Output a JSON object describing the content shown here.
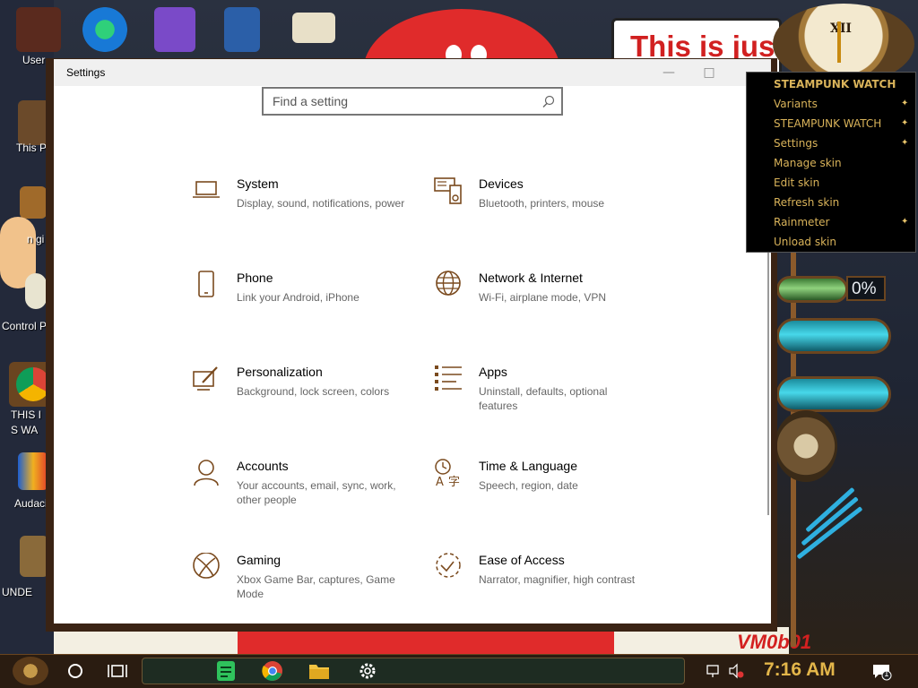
{
  "desktop": {
    "banner_text": "This is jus",
    "watermark": "VM0b01",
    "icons": [
      {
        "label": "User"
      },
      {
        "label": "This P"
      },
      {
        "label": "n gi"
      },
      {
        "label": "Control P"
      },
      {
        "label": "THIS I"
      },
      {
        "label": "S WA"
      },
      {
        "label": "Audaci"
      },
      {
        "label": "UNDE"
      }
    ]
  },
  "gauges": {
    "percent": "0%"
  },
  "window": {
    "title": "Settings",
    "search": {
      "placeholder": "Find a setting"
    },
    "categories": [
      {
        "title": "System",
        "desc": "Display, sound, notifications, power",
        "icon": "laptop-icon"
      },
      {
        "title": "Devices",
        "desc": "Bluetooth, printers, mouse",
        "icon": "devices-icon"
      },
      {
        "title": "Phone",
        "desc": "Link your Android, iPhone",
        "icon": "phone-icon"
      },
      {
        "title": "Network & Internet",
        "desc": "Wi-Fi, airplane mode, VPN",
        "icon": "globe-icon"
      },
      {
        "title": "Personalization",
        "desc": "Background, lock screen, colors",
        "icon": "paint-brush-icon"
      },
      {
        "title": "Apps",
        "desc": "Uninstall, defaults, optional features",
        "icon": "apps-list-icon"
      },
      {
        "title": "Accounts",
        "desc": "Your accounts, email, sync, work, other people",
        "icon": "person-icon"
      },
      {
        "title": "Time & Language",
        "desc": "Speech, region, date",
        "icon": "time-language-icon"
      },
      {
        "title": "Gaming",
        "desc": "Xbox Game Bar, captures, Game Mode",
        "icon": "xbox-icon"
      },
      {
        "title": "Ease of Access",
        "desc": "Narrator, magnifier, high contrast",
        "icon": "ease-of-access-icon"
      }
    ]
  },
  "menu": {
    "header": "STEAMPUNK WATCH",
    "items": [
      {
        "label": "Variants",
        "submenu": true
      },
      {
        "label": "STEAMPUNK WATCH",
        "submenu": true
      },
      {
        "label": "Settings",
        "submenu": true
      },
      {
        "label": "Manage skin",
        "submenu": false
      },
      {
        "label": "Edit skin",
        "submenu": false
      },
      {
        "label": "Refresh skin",
        "submenu": false
      },
      {
        "label": "Rainmeter",
        "submenu": true
      },
      {
        "label": "Unload skin",
        "submenu": false
      }
    ]
  },
  "taskbar": {
    "time": "7:16 AM",
    "notification_count": "1"
  },
  "colors": {
    "accent": "#7a4a1e",
    "menu_text": "#d9b35a",
    "clock_text": "#e3b64a"
  }
}
